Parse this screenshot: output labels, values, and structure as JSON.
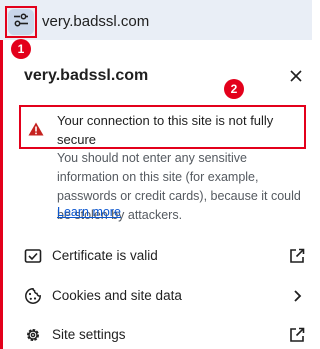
{
  "address_bar": {
    "url": "very.badssl.com",
    "site_info_icon": "tune-icon"
  },
  "annotations": {
    "badge_1": "1",
    "badge_2": "2",
    "highlight_color": "#e3001b"
  },
  "popup": {
    "title": "very.badssl.com",
    "close_icon": "close-icon",
    "warning": {
      "icon": "warning-triangle-icon",
      "icon_color": "#c5221f",
      "title": "Your connection to this site is not fully secure",
      "description": "You should not enter any sensitive information on this site (for example, passwords or credit cards), because it could be stolen by attackers.",
      "learn_more": "Learn more"
    },
    "items": [
      {
        "label": "Certificate is valid",
        "icon": "certificate-icon",
        "end_icon": "open-in-new-icon"
      },
      {
        "label": "Cookies and site data",
        "icon": "cookie-icon",
        "end_icon": "chevron-right-icon"
      },
      {
        "label": "Site settings",
        "icon": "gear-icon",
        "end_icon": "open-in-new-icon"
      }
    ]
  }
}
